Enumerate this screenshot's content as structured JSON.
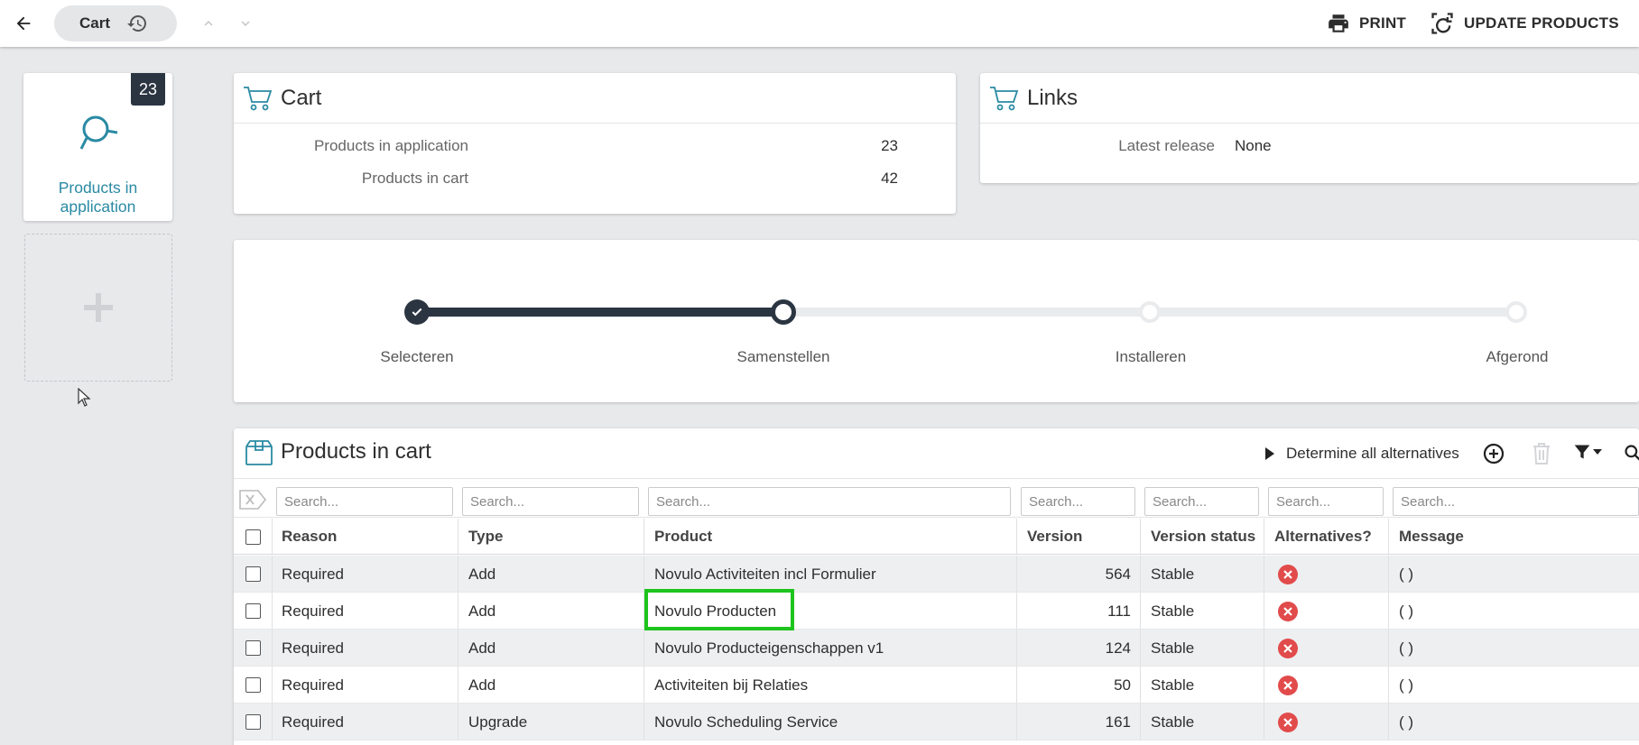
{
  "topbar": {
    "tab_label": "Cart",
    "print_label": "PRINT",
    "update_label": "UPDATE PRODUCTS"
  },
  "tile": {
    "badge": "23",
    "label_line1": "Products in",
    "label_line2": "application"
  },
  "cart_card": {
    "title": "Cart",
    "rows": [
      {
        "label": "Products in application",
        "value": "23"
      },
      {
        "label": "Products in cart",
        "value": "42"
      }
    ]
  },
  "links_card": {
    "title": "Links",
    "rows": [
      {
        "label": "Latest release",
        "value": "None"
      }
    ]
  },
  "stepper": {
    "steps": [
      {
        "label": "Selecteren",
        "state": "done"
      },
      {
        "label": "Samenstellen",
        "state": "current"
      },
      {
        "label": "Installeren",
        "state": "pending"
      },
      {
        "label": "Afgerond",
        "state": "pending"
      }
    ]
  },
  "products": {
    "title": "Products in cart",
    "determine_label": "Determine all alternatives",
    "search_placeholder": "Search...",
    "columns": [
      "Reason",
      "Type",
      "Product",
      "Version",
      "Version status",
      "Alternatives?",
      "Message"
    ],
    "rows": [
      {
        "reason": "Required",
        "type": "Add",
        "product": "Novulo Activiteiten incl Formulier",
        "version": "564",
        "status": "Stable",
        "message": "( )"
      },
      {
        "reason": "Required",
        "type": "Add",
        "product": "Novulo Producten",
        "version": "111",
        "status": "Stable",
        "message": "( )"
      },
      {
        "reason": "Required",
        "type": "Add",
        "product": "Novulo Producteigenschappen v1",
        "version": "124",
        "status": "Stable",
        "message": "( )"
      },
      {
        "reason": "Required",
        "type": "Add",
        "product": "Activiteiten bij Relaties",
        "version": "50",
        "status": "Stable",
        "message": "( )"
      },
      {
        "reason": "Required",
        "type": "Upgrade",
        "product": "Novulo Scheduling Service",
        "version": "161",
        "status": "Stable",
        "message": "( )"
      }
    ]
  },
  "colors": {
    "accent_teal": "#2a8aa3",
    "dark_navy": "#2b3542",
    "error_red": "#e14b4b",
    "highlight_green": "#1ec41e"
  }
}
